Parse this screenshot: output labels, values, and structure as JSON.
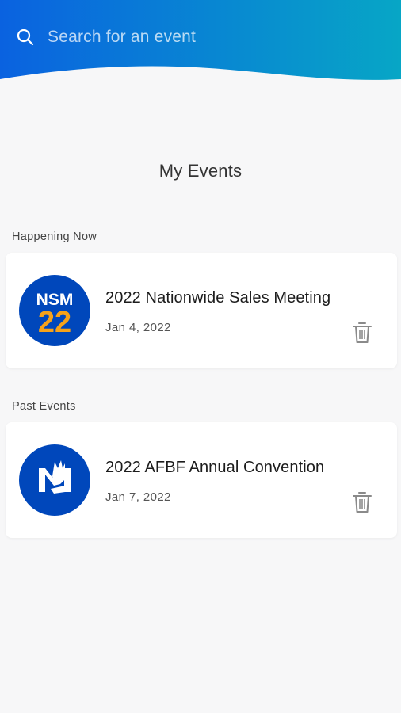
{
  "search": {
    "placeholder": "Search for an event",
    "icon": "search-icon"
  },
  "page_title": "My Events",
  "sections": [
    {
      "label": "Happening Now",
      "events": [
        {
          "title": "2022 Nationwide Sales Meeting",
          "date": "Jan 4, 2022",
          "logo_line1": "NSM",
          "logo_line2": "22"
        }
      ]
    },
    {
      "label": "Past Events",
      "events": [
        {
          "title": "2022 AFBF Annual Convention",
          "date": "Jan 7, 2022"
        }
      ]
    }
  ],
  "colors": {
    "header_gradient_start": "#0a62e0",
    "header_gradient_end": "#07a6c6",
    "logo_blue": "#0047bb",
    "logo_accent": "#f6a21a",
    "background": "#f7f7f8"
  }
}
